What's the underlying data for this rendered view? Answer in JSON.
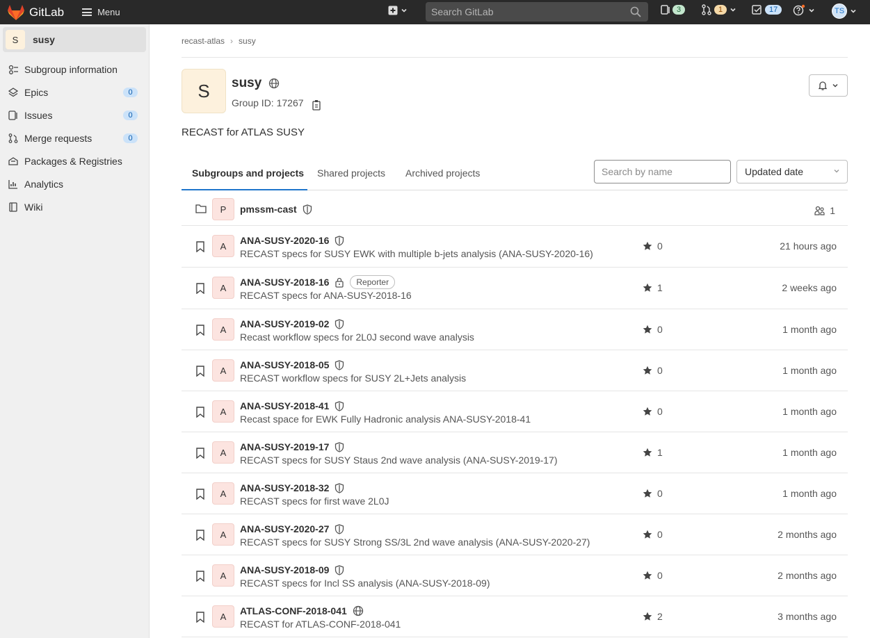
{
  "topbar": {
    "brand": "GitLab",
    "menu_label": "Menu",
    "search_placeholder": "Search GitLab",
    "issues_count": "3",
    "mr_count": "1",
    "todos_count": "17",
    "user_initials": "TS"
  },
  "sidebar": {
    "context_initial": "S",
    "context_name": "susy",
    "items": [
      {
        "label": "Subgroup information",
        "icon": "group-info-icon"
      },
      {
        "label": "Epics",
        "count": "0",
        "icon": "epic-icon"
      },
      {
        "label": "Issues",
        "count": "0",
        "icon": "issues-icon"
      },
      {
        "label": "Merge requests",
        "count": "0",
        "icon": "merge-request-icon"
      },
      {
        "label": "Packages & Registries",
        "icon": "package-icon"
      },
      {
        "label": "Analytics",
        "icon": "chart-icon"
      },
      {
        "label": "Wiki",
        "icon": "book-icon"
      }
    ]
  },
  "breadcrumb": [
    "recast-atlas",
    "susy"
  ],
  "group": {
    "initial": "S",
    "name": "susy",
    "id_label": "Group ID: 17267",
    "description": "RECAST for ATLAS SUSY"
  },
  "tabs": [
    "Subgroups and projects",
    "Shared projects",
    "Archived projects"
  ],
  "filter": {
    "search_placeholder": "Search by name",
    "sort_label": "Updated date"
  },
  "subgroup": {
    "initial": "P",
    "name": "pmssm-cast",
    "members": "1"
  },
  "projects": [
    {
      "initial": "A",
      "name": "ANA-SUSY-2020-16",
      "vis": "internal",
      "desc": "RECAST specs for SUSY EWK with multiple b-jets analysis (ANA-SUSY-2020-16)",
      "stars": "0",
      "updated": "21 hours ago"
    },
    {
      "initial": "A",
      "name": "ANA-SUSY-2018-16",
      "vis": "private",
      "role": "Reporter",
      "desc": "RECAST specs for ANA-SUSY-2018-16",
      "stars": "1",
      "updated": "2 weeks ago"
    },
    {
      "initial": "A",
      "name": "ANA-SUSY-2019-02",
      "vis": "internal",
      "desc": "Recast workflow specs for 2L0J second wave analysis",
      "stars": "0",
      "updated": "1 month ago"
    },
    {
      "initial": "A",
      "name": "ANA-SUSY-2018-05",
      "vis": "internal",
      "desc": "RECAST workflow specs for SUSY 2L+Jets analysis",
      "stars": "0",
      "updated": "1 month ago"
    },
    {
      "initial": "A",
      "name": "ANA-SUSY-2018-41",
      "vis": "internal",
      "desc": "Recast space for EWK Fully Hadronic analysis ANA-SUSY-2018-41",
      "stars": "0",
      "updated": "1 month ago"
    },
    {
      "initial": "A",
      "name": "ANA-SUSY-2019-17",
      "vis": "internal",
      "desc": "RECAST specs for SUSY Staus 2nd wave analysis (ANA-SUSY-2019-17)",
      "stars": "1",
      "updated": "1 month ago"
    },
    {
      "initial": "A",
      "name": "ANA-SUSY-2018-32",
      "vis": "internal",
      "desc": "RECAST specs for first wave 2L0J",
      "stars": "0",
      "updated": "1 month ago"
    },
    {
      "initial": "A",
      "name": "ANA-SUSY-2020-27",
      "vis": "internal",
      "desc": "RECAST specs for SUSY Strong SS/3L 2nd wave analysis (ANA-SUSY-2020-27)",
      "stars": "0",
      "updated": "2 months ago"
    },
    {
      "initial": "A",
      "name": "ANA-SUSY-2018-09",
      "vis": "internal",
      "desc": "RECAST specs for Incl SS analysis (ANA-SUSY-2018-09)",
      "stars": "0",
      "updated": "2 months ago"
    },
    {
      "initial": "A",
      "name": "ATLAS-CONF-2018-041",
      "vis": "public",
      "desc": "RECAST for ATLAS-CONF-2018-041",
      "stars": "2",
      "updated": "3 months ago"
    }
  ]
}
